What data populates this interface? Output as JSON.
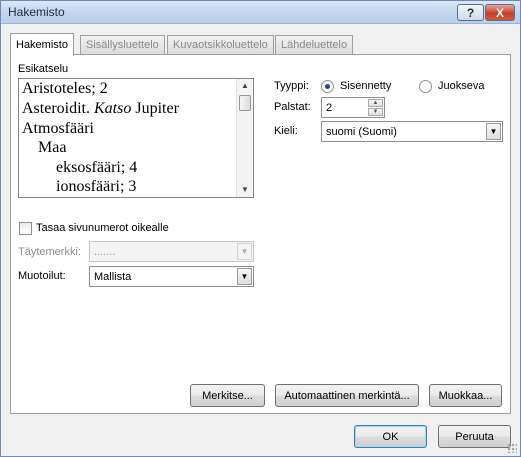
{
  "window": {
    "title": "Hakemisto",
    "help_button": "?",
    "close_button": "X"
  },
  "tabs": [
    {
      "label": "Hakemisto"
    },
    {
      "label": "Sisällysluettelo"
    },
    {
      "label": "Kuvaotsikkoluettelo"
    },
    {
      "label": "Lähdeluettelo"
    }
  ],
  "preview": {
    "label": "Esikatselu",
    "lines": [
      {
        "text": "Aristoteles; 2"
      },
      {
        "text": "Asteroidit. ",
        "italic": "Katso",
        "text2": " Jupiter"
      },
      {
        "text": "Atmosfääri"
      },
      {
        "text": "Maa"
      },
      {
        "text": "eksosfääri; 4"
      },
      {
        "text": "ionosfääri; 3"
      }
    ]
  },
  "type": {
    "label": "Tyyppi:",
    "options": [
      {
        "label": "Sisennetty",
        "checked": true
      },
      {
        "label": "Juokseva",
        "checked": false
      }
    ]
  },
  "columns": {
    "label": "Palstat:",
    "value": "2"
  },
  "language": {
    "label": "Kieli:",
    "value": "suomi (Suomi)"
  },
  "align_right": {
    "label": "Tasaa sivunumerot oikealle",
    "checked": false
  },
  "tab_leader": {
    "label": "Täytemerkki:",
    "value": ".......",
    "disabled": true
  },
  "formats": {
    "label": "Muotoilut:",
    "value": "Mallista"
  },
  "buttons": {
    "mark": "Merkitse...",
    "automark": "Automaattinen merkintä...",
    "modify": "Muokkaa...",
    "ok": "OK",
    "cancel": "Peruuta"
  },
  "icons": {
    "help": "question-mark-icon",
    "close": "close-icon",
    "dropdown": "chevron-down-icon",
    "spin_up": "spin-up-icon",
    "spin_down": "spin-down-icon"
  },
  "colors": {
    "title_bar": "#c2d6ee",
    "close_button": "#c4412a",
    "default_button_border": "#3c7fb1"
  }
}
